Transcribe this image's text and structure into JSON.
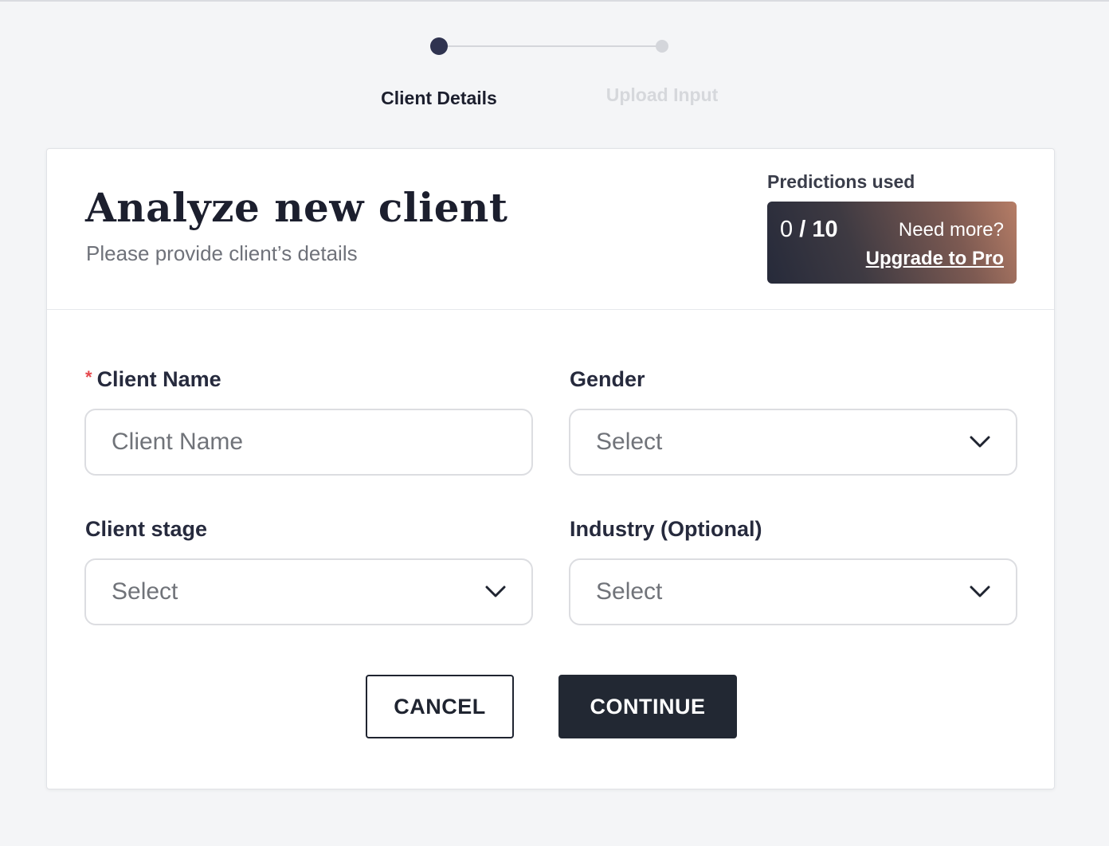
{
  "stepper": {
    "steps": [
      {
        "label": "Client Details",
        "state": "active"
      },
      {
        "label": "Upload Input",
        "state": "inactive"
      }
    ]
  },
  "header": {
    "title": "Analyze new client",
    "subtitle": "Please provide client’s details"
  },
  "predictions": {
    "label": "Predictions used",
    "used": "0",
    "separator": " / ",
    "total": "10",
    "need_more": "Need more?",
    "upgrade_link": "Upgrade to Pro"
  },
  "form": {
    "client_name": {
      "required_mark": "*",
      "label": "Client Name",
      "placeholder": "Client Name",
      "value": ""
    },
    "gender": {
      "label": "Gender",
      "selected": "Select"
    },
    "client_stage": {
      "label": "Client stage",
      "selected": "Select"
    },
    "industry": {
      "label": "Industry (Optional)",
      "selected": "Select"
    }
  },
  "actions": {
    "cancel_label": "CANCEL",
    "continue_label": "CONTINUE"
  },
  "colors": {
    "primary": "#222833",
    "step_active": "#2f3350",
    "step_inactive": "#d4d6db",
    "required": "#e5484d",
    "background": "#f4f5f7"
  }
}
